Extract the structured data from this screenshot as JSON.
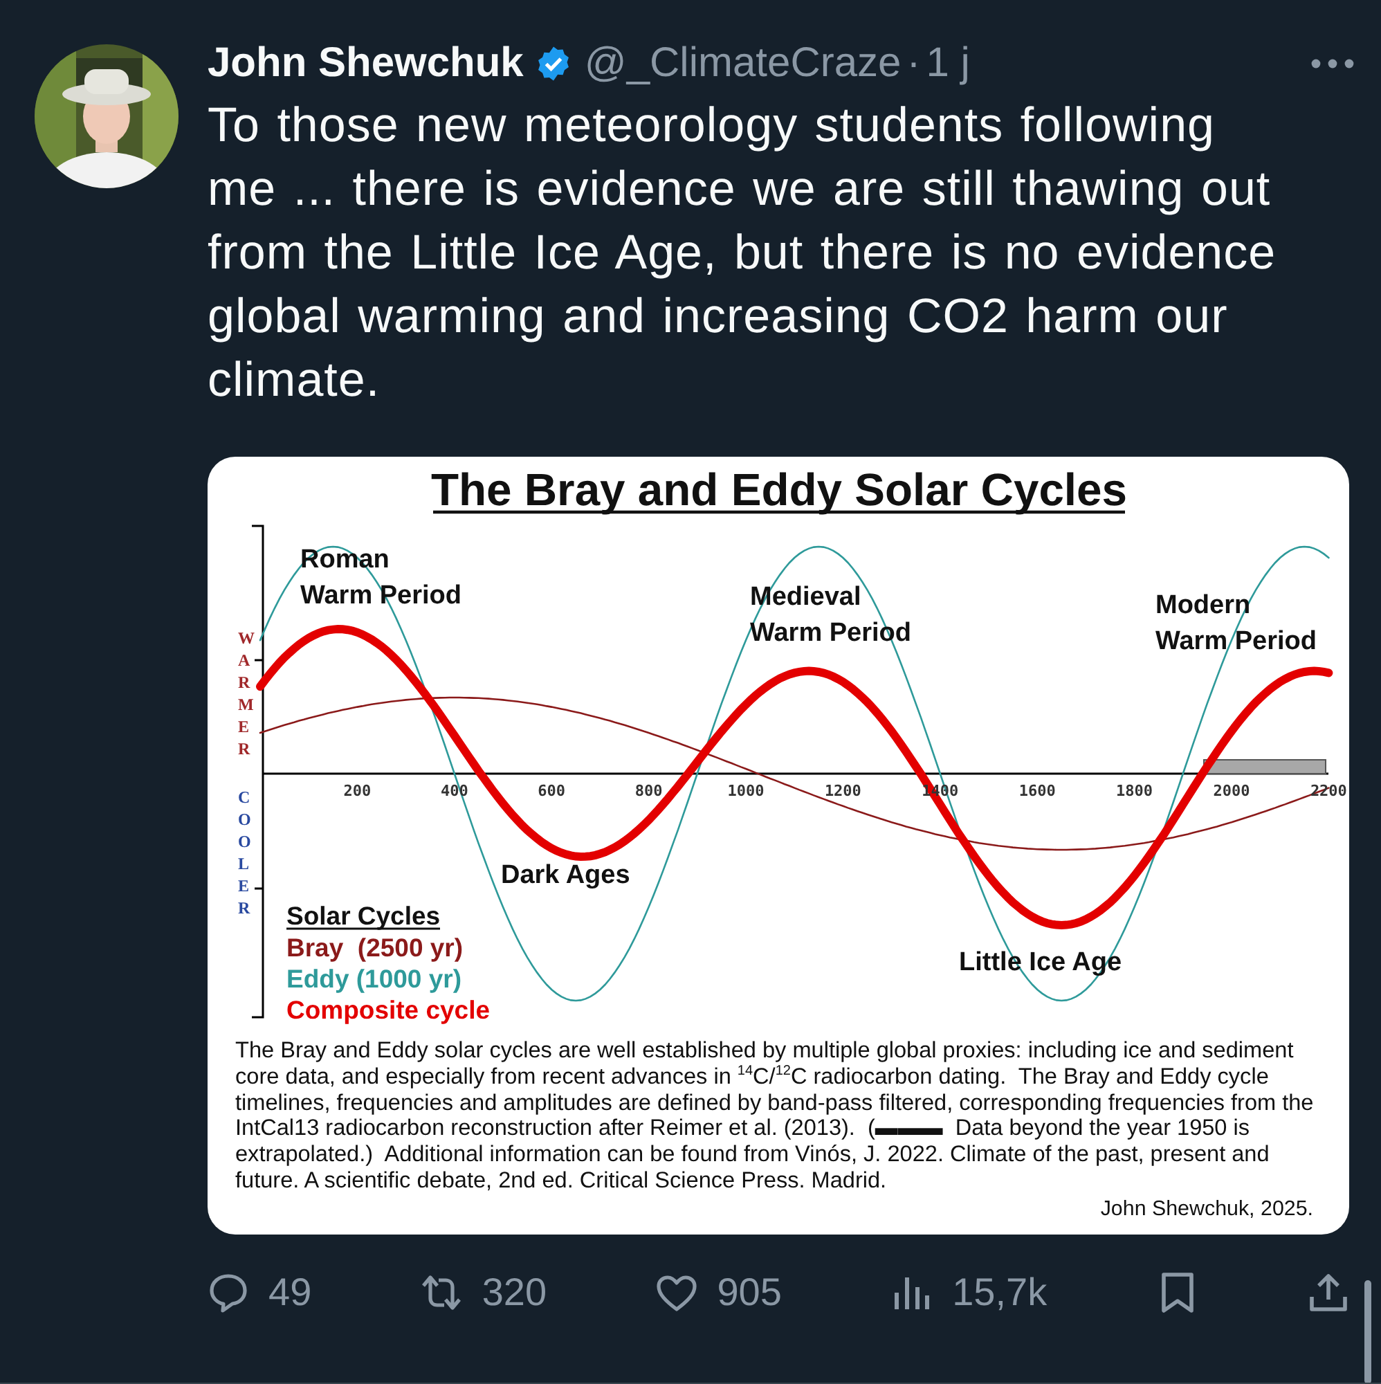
{
  "tweet": {
    "author": {
      "name": "John Shewchuk",
      "verified": true,
      "handle": "@_ClimateCraze",
      "separator": "·",
      "time": "1 j"
    },
    "text": "To those new meteorology students following me ... there is evidence we are still thawing out from the Little Ice Age, but there is no evidence global warming and increasing CO2 harm our climate.",
    "image": {
      "title": "The Bray and Eddy Solar Cycles",
      "axis_warmer": "WARMER",
      "axis_cooler": "COOLER",
      "x_ticks": [
        "200",
        "400",
        "600",
        "800",
        "1000",
        "1200",
        "1400",
        "1600",
        "1800",
        "2000",
        "2200"
      ],
      "period_labels": [
        {
          "lines": [
            "Roman",
            "Warm Period"
          ]
        },
        {
          "lines": [
            "Medieval",
            "Warm Period"
          ]
        },
        {
          "lines": [
            "Modern",
            "Warm Period"
          ]
        },
        {
          "lines": [
            "Dark Ages"
          ]
        },
        {
          "lines": [
            "Little Ice Age"
          ]
        }
      ],
      "legend": {
        "title": "Solar Cycles",
        "items": [
          {
            "label": "Bray  (2500 yr)",
            "color": "#8b1a1a"
          },
          {
            "label": "Eddy (1000 yr)",
            "color": "#2e9a9a"
          },
          {
            "label": "Composite cycle",
            "color": "#e30000"
          }
        ]
      },
      "caption": "The Bray and Eddy solar cycles are well established by multiple global proxies: including ice and sediment core data, and especially from recent advances in $^{14}$C/$^{12}$C radiocarbon dating.  The Bray and Eddy cycle timelines, frequencies and amplitudes are defined by band-pass filtered, corresponding frequencies from the IntCal13 radiocarbon reconstruction after Reimer et al. (2013).  (▬▬▬  Data beyond the year 1950 is extrapolated.)  Additional information can be found from Vinós, J. 2022. Climate of the past, present and future. A scientific debate, 2nd ed. Critical Science Press. Madrid.",
      "credit": "John Shewchuk, 2025."
    },
    "actions": [
      {
        "kind": "reply",
        "count": "49"
      },
      {
        "kind": "repost",
        "count": "320"
      },
      {
        "kind": "like",
        "count": "905"
      },
      {
        "kind": "views",
        "count": "15,7k"
      },
      {
        "kind": "bookmark"
      },
      {
        "kind": "share"
      }
    ]
  }
}
